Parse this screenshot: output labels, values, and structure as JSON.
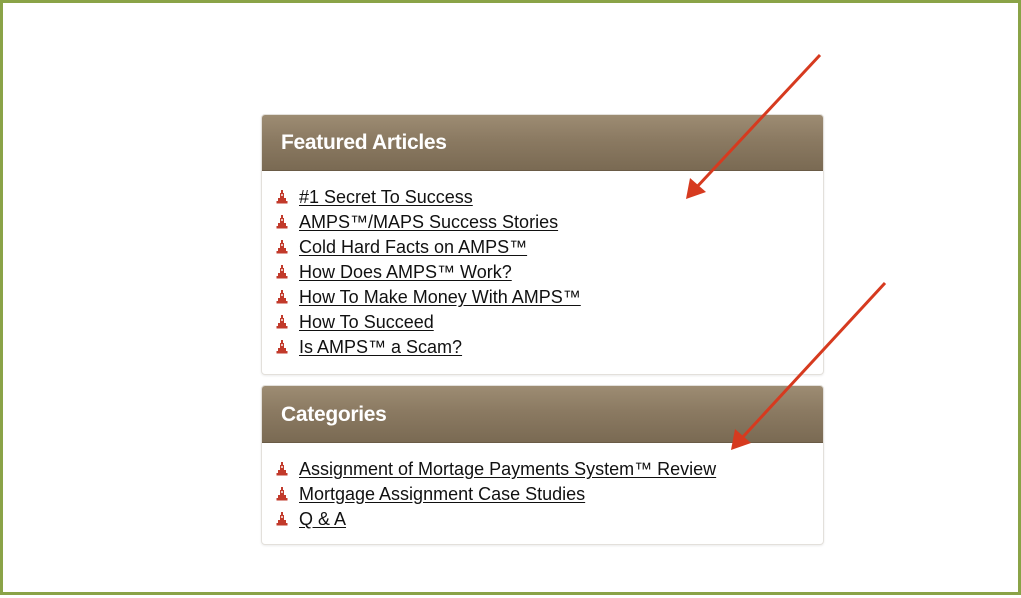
{
  "featured": {
    "title": "Featured Articles",
    "items": [
      "#1 Secret To Success",
      "AMPS™/MAPS Success Stories",
      "Cold Hard Facts on AMPS™",
      "How Does AMPS™ Work?",
      "How To Make Money With AMPS™",
      "How To Succeed",
      "Is AMPS™ a Scam?"
    ]
  },
  "categories": {
    "title": "Categories",
    "items": [
      "Assignment of Mortage Payments System™ Review",
      "Mortgage Assignment Case Studies",
      "Q & A"
    ]
  },
  "colors": {
    "frame_border": "#8aa347",
    "header_bg": "#8b7a62",
    "bullet": "#c23a2b",
    "annotation_arrow": "#d63a1f"
  },
  "icons": {
    "bullet": "tower-bullet-icon",
    "annotation": "red-arrow-icon"
  }
}
